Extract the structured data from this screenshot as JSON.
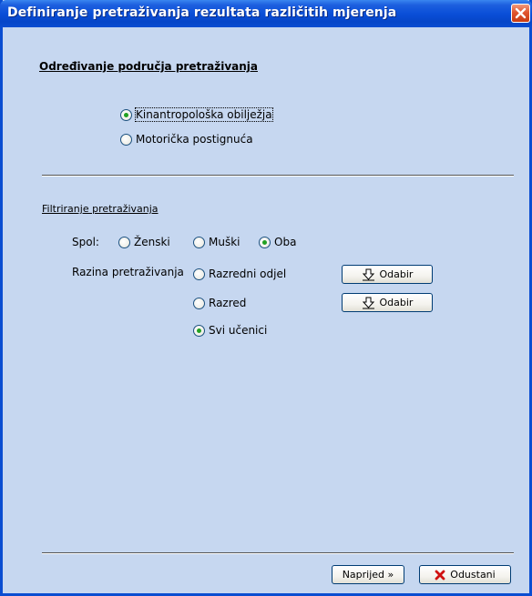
{
  "window": {
    "title": "Definiranje pretraživanja rezultata različitih mjerenja",
    "title_bar_color": "#0a4dd1",
    "body_color": "#c6d7f0"
  },
  "search_area": {
    "heading": "Određivanje područja pretraživanja",
    "options": [
      {
        "label": "Kinantropološka obilježja",
        "checked": true
      },
      {
        "label": "Motorička postignuća",
        "checked": false
      }
    ]
  },
  "filter": {
    "group_label": "Filtriranje pretraživanja",
    "gender": {
      "label": "Spol:",
      "options": [
        {
          "label": "Ženski",
          "checked": false
        },
        {
          "label": "Muški",
          "checked": false
        },
        {
          "label": "Oba",
          "checked": true
        }
      ]
    },
    "level": {
      "label": "Razina pretraživanja",
      "options": [
        {
          "label": "Razredni odjel",
          "checked": false
        },
        {
          "label": "Razred",
          "checked": false
        },
        {
          "label": "Svi učenici",
          "checked": true
        }
      ],
      "choose_label": "Odabir"
    }
  },
  "footer": {
    "next_label": "Naprijed »",
    "cancel_label": "Odustani"
  },
  "icons": {
    "close": "close-icon",
    "choose": "arrow-down-icon",
    "cancel": "red-x-icon"
  }
}
